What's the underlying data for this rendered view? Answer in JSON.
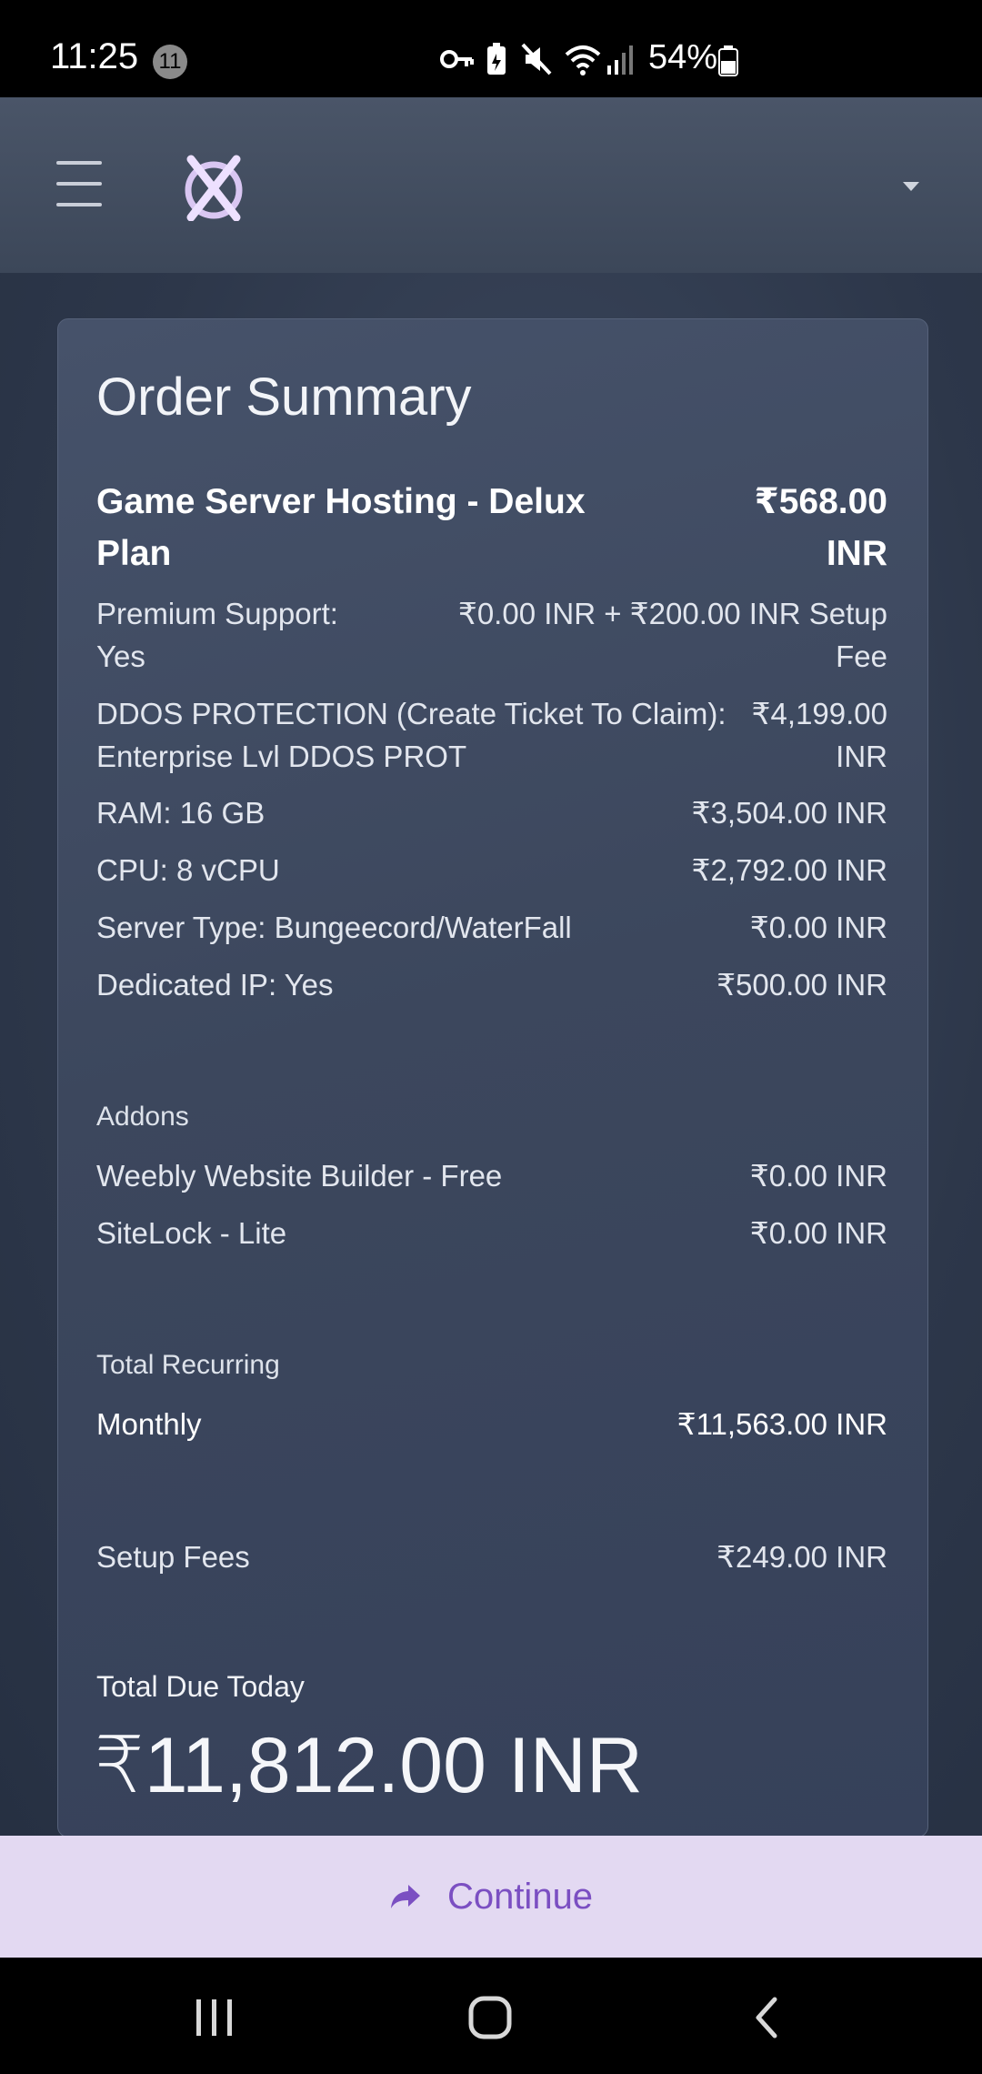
{
  "status_bar": {
    "time": "11:25",
    "notification_count": "11",
    "battery": "54%",
    "icons": [
      "key-icon",
      "battery-saver-icon",
      "mute-icon",
      "wifi-icon",
      "signal-icon",
      "battery-icon"
    ]
  },
  "header": {
    "menu_icon": "hamburger-icon",
    "logo_icon": "brand-logo-icon",
    "account_icon": "caret-down-icon"
  },
  "order": {
    "title": "Order Summary",
    "product": {
      "name": "Game Server Hosting - Delux Plan",
      "price_line1": "₹568.00",
      "price_line2": "INR"
    },
    "options": [
      {
        "label_line1": "Premium Support:",
        "label_line2": "Yes",
        "value_line1": "₹0.00 INR + ₹200.00 INR Setup",
        "value_line2": "Fee"
      },
      {
        "label_line1": "DDOS PROTECTION (Create Ticket To Claim):",
        "label_line2": "Enterprise Lvl DDOS PROT",
        "value_line1": "₹4,199.00",
        "value_line2": "INR"
      },
      {
        "label": "RAM: 16 GB",
        "value": "₹3,504.00 INR"
      },
      {
        "label": "CPU: 8 vCPU",
        "value": "₹2,792.00 INR"
      },
      {
        "label": "Server Type: Bungeecord/WaterFall",
        "value": "₹0.00 INR"
      },
      {
        "label": "Dedicated IP: Yes",
        "value": "₹500.00 INR"
      }
    ],
    "addons_heading": "Addons",
    "addons": [
      {
        "label": "Weebly Website Builder - Free",
        "value": "₹0.00 INR"
      },
      {
        "label": "SiteLock - Lite",
        "value": "₹0.00 INR"
      }
    ],
    "recurring_heading": "Total Recurring",
    "recurring": {
      "label": "Monthly",
      "value": "₹11,563.00 INR"
    },
    "setup": {
      "label": "Setup Fees",
      "value": "₹249.00 INR"
    },
    "total_due_label": "Total Due Today",
    "total_due_amount": "₹11,812.00 INR"
  },
  "continue_button": {
    "label": "Continue",
    "icon": "share-arrow-icon",
    "color": "#7b4fc2",
    "background": "#e3d9f2"
  },
  "nav_bar": {
    "icons": [
      "recent-apps-icon",
      "home-icon",
      "back-icon"
    ]
  },
  "colors": {
    "header_bg": "#4a5568",
    "card_bg": "#46526a",
    "page_bg": "#2b3547"
  }
}
